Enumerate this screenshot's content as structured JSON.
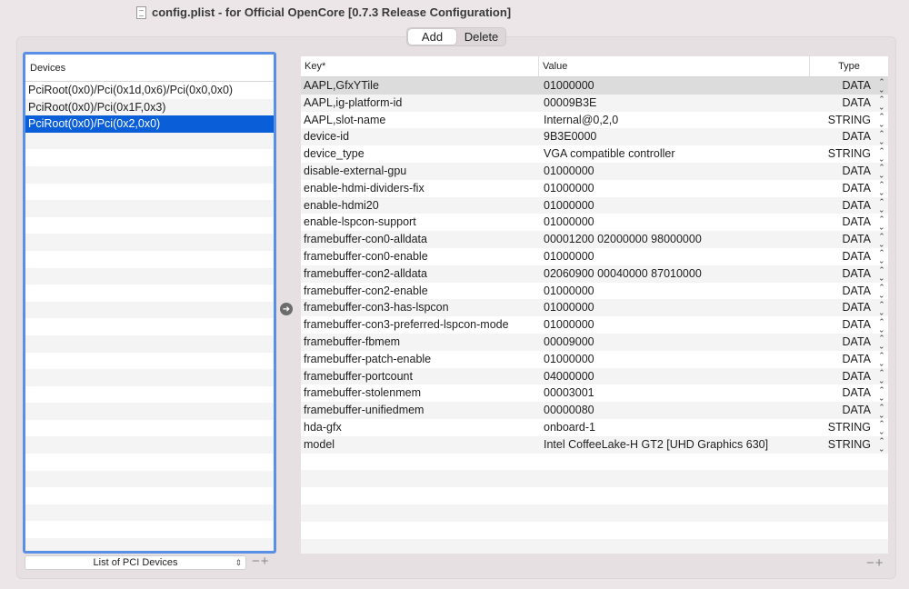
{
  "window": {
    "title": "config.plist - for Official OpenCore [0.7.3 Release Configuration]"
  },
  "segment": {
    "add_label": "Add",
    "delete_label": "Delete"
  },
  "devices": {
    "header": "Devices",
    "items": [
      "PciRoot(0x0)/Pci(0x1d,0x6)/Pci(0x0,0x0)",
      "PciRoot(0x0)/Pci(0x1F,0x3)",
      "PciRoot(0x0)/Pci(0x2,0x0)"
    ],
    "selected_index": 2,
    "list_select_label": "List of PCI Devices",
    "minus": "−",
    "plus": "+"
  },
  "properties": {
    "headers": {
      "key": "Key*",
      "value": "Value",
      "type": "Type"
    },
    "rows": [
      {
        "key": "AAPL,GfxYTile",
        "value": "01000000",
        "type": "DATA"
      },
      {
        "key": "AAPL,ig-platform-id",
        "value": "00009B3E",
        "type": "DATA"
      },
      {
        "key": "AAPL,slot-name",
        "value": "Internal@0,2,0",
        "type": "STRING"
      },
      {
        "key": "device-id",
        "value": "9B3E0000",
        "type": "DATA"
      },
      {
        "key": "device_type",
        "value": "VGA compatible controller",
        "type": "STRING"
      },
      {
        "key": "disable-external-gpu",
        "value": "01000000",
        "type": "DATA"
      },
      {
        "key": "enable-hdmi-dividers-fix",
        "value": "01000000",
        "type": "DATA"
      },
      {
        "key": "enable-hdmi20",
        "value": "01000000",
        "type": "DATA"
      },
      {
        "key": "enable-lspcon-support",
        "value": "01000000",
        "type": "DATA"
      },
      {
        "key": "framebuffer-con0-alldata",
        "value": "00001200 02000000 98000000",
        "type": "DATA"
      },
      {
        "key": "framebuffer-con0-enable",
        "value": "01000000",
        "type": "DATA"
      },
      {
        "key": "framebuffer-con2-alldata",
        "value": "02060900 00040000 87010000",
        "type": "DATA"
      },
      {
        "key": "framebuffer-con2-enable",
        "value": "01000000",
        "type": "DATA"
      },
      {
        "key": "framebuffer-con3-has-lspcon",
        "value": "01000000",
        "type": "DATA"
      },
      {
        "key": "framebuffer-con3-preferred-lspcon-mode",
        "value": "01000000",
        "type": "DATA"
      },
      {
        "key": "framebuffer-fbmem",
        "value": "00009000",
        "type": "DATA"
      },
      {
        "key": "framebuffer-patch-enable",
        "value": "01000000",
        "type": "DATA"
      },
      {
        "key": "framebuffer-portcount",
        "value": "04000000",
        "type": "DATA"
      },
      {
        "key": "framebuffer-stolenmem",
        "value": "00003001",
        "type": "DATA"
      },
      {
        "key": "framebuffer-unifiedmem",
        "value": "00000080",
        "type": "DATA"
      },
      {
        "key": "hda-gfx",
        "value": "onboard-1",
        "type": "STRING"
      },
      {
        "key": "model",
        "value": "Intel CoffeeLake-H GT2 [UHD Graphics 630]",
        "type": "STRING"
      }
    ],
    "minus": "−",
    "plus": "+"
  },
  "icons": {
    "arrow": "right-arrow-circle-icon",
    "stepper": "up-down-stepper-icon"
  }
}
